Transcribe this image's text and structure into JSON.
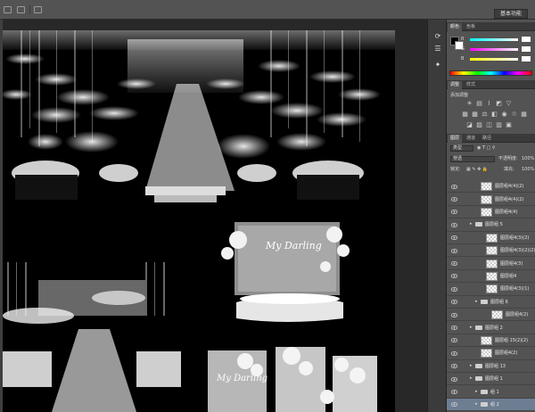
{
  "app": {
    "workspace_label": "基本功能"
  },
  "panels": {
    "color_tabs": [
      "颜色",
      "色板"
    ],
    "channels": [
      {
        "label": "R",
        "value": 255
      },
      {
        "label": "G",
        "value": 255
      },
      {
        "label": "B",
        "value": 255
      }
    ],
    "foreground_color": "#000000",
    "background_color": "#ffffff",
    "adjust_tabs": [
      "调整",
      "样式"
    ],
    "adjust_title": "添加调整",
    "adjust_icons_row1": [
      "brightness-icon",
      "levels-icon",
      "curves-icon",
      "exposure-icon",
      "triangle-icon"
    ],
    "adjust_icons_row2": [
      "vibrance-icon",
      "hue-icon",
      "balance-icon",
      "bw-icon",
      "photo-filter-icon",
      "channel-mixer-icon",
      "lookup-icon"
    ],
    "adjust_icons_row3": [
      "invert-icon",
      "posterize-icon",
      "threshold-icon",
      "gradient-map-icon",
      "selective-color-icon"
    ],
    "layer_tabs": [
      "图层",
      "通道",
      "路径"
    ],
    "kind_filter": "类型",
    "blend_mode": "穿透",
    "opacity_label": "不透明度:",
    "opacity_value": "100%",
    "lock_label": "锁定:",
    "fill_label": "填充:",
    "fill_value": "100%"
  },
  "layers": [
    {
      "name": "图层组4(4)(2)",
      "kind": "layer",
      "indent": 0,
      "selected": false
    },
    {
      "name": "图层组4(4)(2)",
      "kind": "layer",
      "indent": 0,
      "selected": false
    },
    {
      "name": "图层组4(4)",
      "kind": "layer",
      "indent": 0,
      "selected": false
    },
    {
      "name": "图层组 5",
      "kind": "group",
      "indent": 0,
      "selected": false
    },
    {
      "name": "图层组4(3)(2)",
      "kind": "layer",
      "indent": 1,
      "selected": false
    },
    {
      "name": "图层组4(3)(2)(2)",
      "kind": "layer",
      "indent": 1,
      "selected": false
    },
    {
      "name": "图层组4(3)",
      "kind": "layer",
      "indent": 1,
      "selected": false
    },
    {
      "name": "图层组4",
      "kind": "layer",
      "indent": 1,
      "selected": false
    },
    {
      "name": "图层组4(3)(1)",
      "kind": "layer",
      "indent": 1,
      "selected": false
    },
    {
      "name": "图层组 6",
      "kind": "group",
      "indent": 1,
      "selected": false
    },
    {
      "name": "图层组4(2)",
      "kind": "layer",
      "indent": 2,
      "selected": false
    },
    {
      "name": "图层组 2",
      "kind": "group",
      "indent": 0,
      "selected": false
    },
    {
      "name": "图层组 15(2)(2)",
      "kind": "layer",
      "indent": 0,
      "selected": false
    },
    {
      "name": "图层组4(2)",
      "kind": "layer",
      "indent": 0,
      "selected": false
    },
    {
      "name": "图层组 13",
      "kind": "group",
      "indent": 0,
      "selected": false
    },
    {
      "name": "图层组 1",
      "kind": "group",
      "indent": 0,
      "selected": false
    },
    {
      "name": "组 1",
      "kind": "group",
      "indent": 1,
      "selected": false
    },
    {
      "name": "组 2",
      "kind": "group",
      "indent": 1,
      "selected": true
    }
  ],
  "canvas": {
    "sign_text_top": "My Darling",
    "sign_text_bottom": "My Darling"
  }
}
